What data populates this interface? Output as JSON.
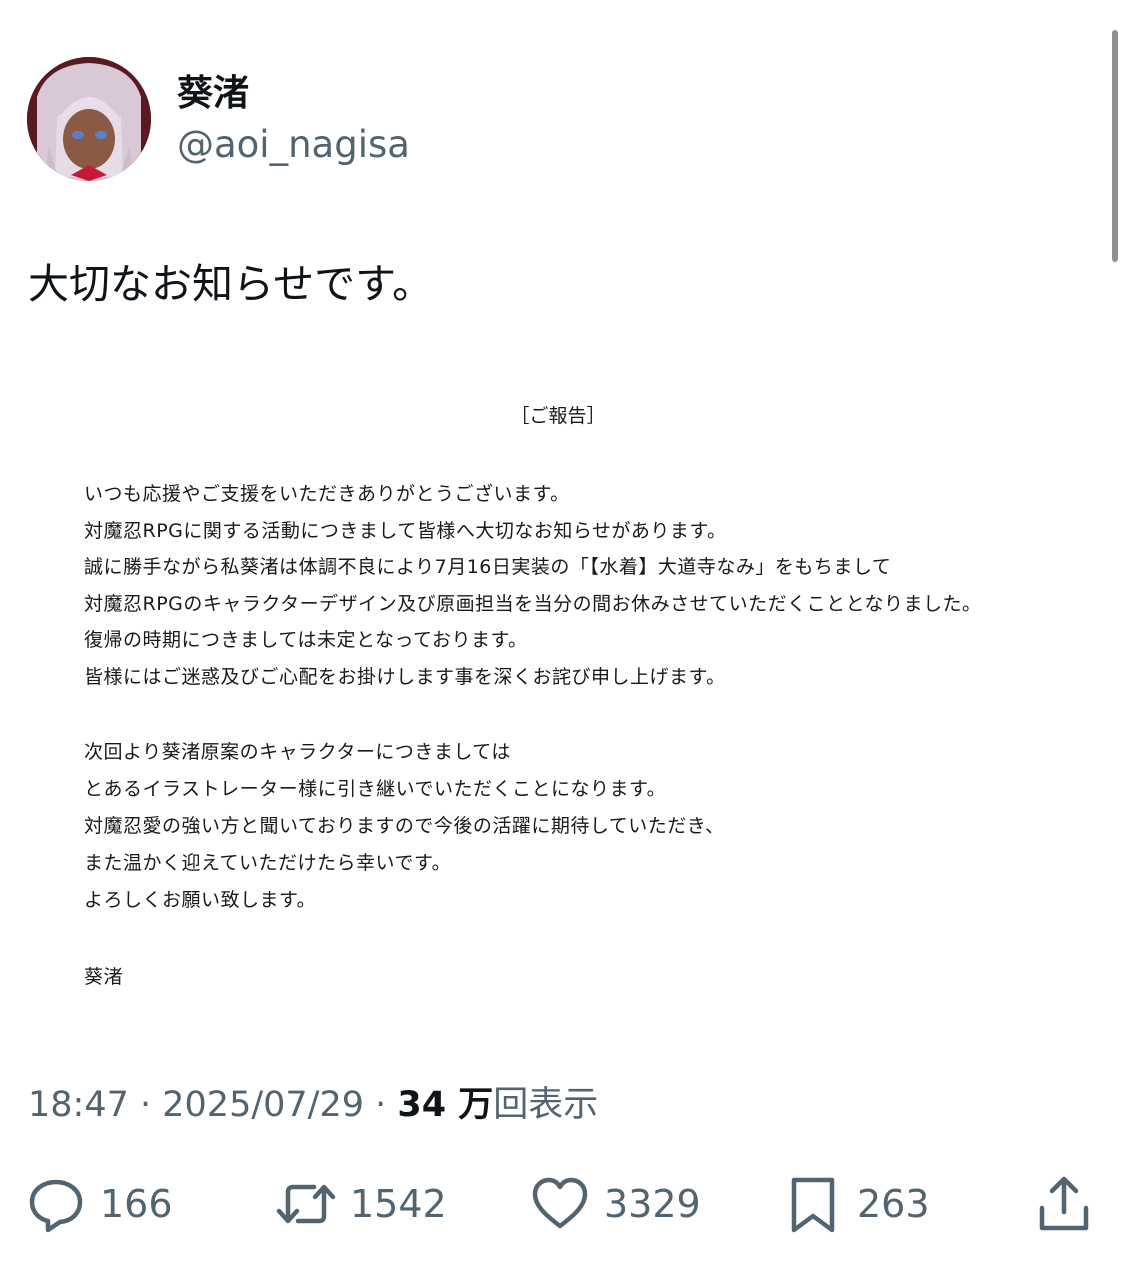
{
  "author": {
    "display_name": "葵渚",
    "handle": "@aoi_nagisa"
  },
  "tweet": {
    "text": "大切なお知らせです。"
  },
  "notice": {
    "title": "［ご報告］",
    "paragraph1": [
      "いつも応援やご支援をいただきありがとうございます。",
      "対魔忍RPGに関する活動につきまして皆様へ大切なお知らせがあります。",
      "誠に勝手ながら私葵渚は体調不良により7月16日実装の「【水着】大道寺なみ」をもちまして",
      "対魔忍RPGのキャラクターデザイン及び原画担当を当分の間お休みさせていただくこととなりました。",
      "復帰の時期につきましては未定となっております。",
      "皆様にはご迷惑及びご心配をお掛けします事を深くお詫び申し上げます。"
    ],
    "paragraph2": [
      "次回より葵渚原案のキャラクターにつきましては",
      "とあるイラストレーター様に引き継いでいただくことになります。",
      "対魔忍愛の強い方と聞いておりますので今後の活躍に期待していただき、",
      "また温かく迎えていただけたら幸いです。",
      "よろしくお願い致します。"
    ],
    "signature": "葵渚"
  },
  "meta": {
    "time": "18:47",
    "separator": " · ",
    "date": "2025/07/29",
    "views_count": "34 万",
    "views_label": "回表示"
  },
  "actions": {
    "replies": "166",
    "reposts": "1542",
    "likes": "3329",
    "bookmarks": "263"
  },
  "icons": {
    "reply": "reply-icon",
    "repost": "repost-icon",
    "like": "heart-icon",
    "bookmark": "bookmark-icon",
    "share": "share-icon"
  },
  "colors": {
    "text_primary": "#0f1419",
    "text_secondary": "#536471"
  }
}
